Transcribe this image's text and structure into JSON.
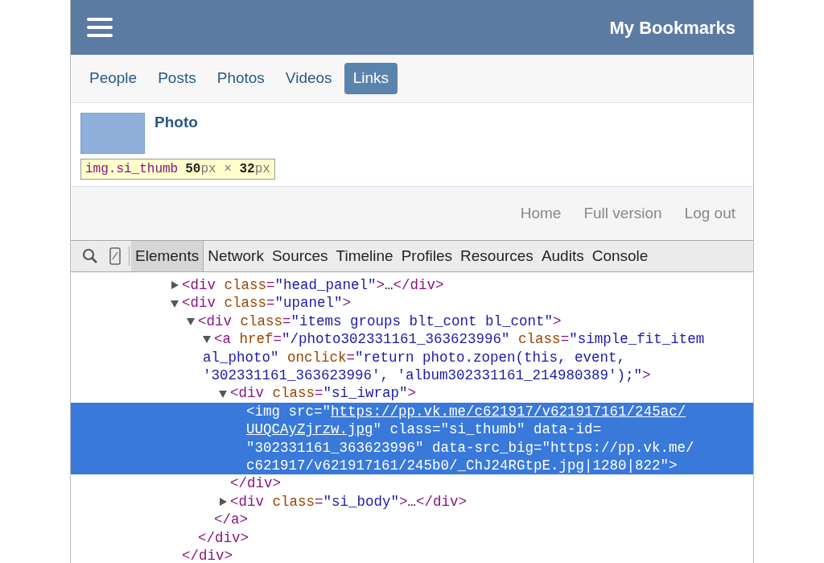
{
  "header": {
    "title": "My Bookmarks"
  },
  "tabs": [
    {
      "label": "People",
      "selected": false
    },
    {
      "label": "Posts",
      "selected": false
    },
    {
      "label": "Photos",
      "selected": false
    },
    {
      "label": "Videos",
      "selected": false
    },
    {
      "label": "Links",
      "selected": true
    }
  ],
  "item": {
    "title": "Photo",
    "highlighted": true
  },
  "tooltip": {
    "selector": "img.si_thumb",
    "size": "**50**px × **32**px"
  },
  "footer_links": [
    "Home",
    "Full version",
    "Log out"
  ],
  "devtools": {
    "tabs": [
      {
        "label": "Elements",
        "selected": true
      },
      {
        "label": "Network",
        "selected": false
      },
      {
        "label": "Sources",
        "selected": false
      },
      {
        "label": "Timeline",
        "selected": false
      },
      {
        "label": "Profiles",
        "selected": false
      },
      {
        "label": "Resources",
        "selected": false
      },
      {
        "label": "Audits",
        "selected": false
      },
      {
        "label": "Console",
        "selected": false
      }
    ],
    "tree": [
      {
        "expanded": false,
        "selected": false,
        "lines": [
          [
            {
              "kind": "tag",
              "text": "<div "
            },
            {
              "kind": "attr",
              "text": "class"
            },
            {
              "kind": "tag",
              "text": "="
            },
            {
              "kind": "value",
              "text": "\"head_panel\""
            },
            {
              "kind": "tag",
              "text": ">"
            },
            {
              "kind": "plain",
              "text": "…"
            },
            {
              "kind": "tag",
              "text": "</div>"
            }
          ]
        ]
      },
      {
        "expanded": true,
        "selected": false,
        "lines": [
          [
            {
              "kind": "tag",
              "text": "<div "
            },
            {
              "kind": "attr",
              "text": "class"
            },
            {
              "kind": "tag",
              "text": "="
            },
            {
              "kind": "value",
              "text": "\"upanel\""
            },
            {
              "kind": "tag",
              "text": ">"
            }
          ]
        ],
        "closing": "</div>",
        "children": [
          {
            "expanded": true,
            "selected": false,
            "lines": [
              [
                {
                  "kind": "tag",
                  "text": "<div "
                },
                {
                  "kind": "attr",
                  "text": "class"
                },
                {
                  "kind": "tag",
                  "text": "="
                },
                {
                  "kind": "value",
                  "text": "\"items groups blt_cont bl_cont\""
                },
                {
                  "kind": "tag",
                  "text": ">"
                }
              ]
            ],
            "closing": "</div>",
            "children": [
              {
                "expanded": true,
                "selected": false,
                "lines": [
                  [
                    {
                      "kind": "tag",
                      "text": "<a "
                    },
                    {
                      "kind": "attr",
                      "text": "href"
                    },
                    {
                      "kind": "tag",
                      "text": "="
                    },
                    {
                      "kind": "value",
                      "text": "\"/photo302331161_363623996\" "
                    },
                    {
                      "kind": "attr",
                      "text": "class"
                    },
                    {
                      "kind": "tag",
                      "text": "="
                    },
                    {
                      "kind": "value",
                      "text": "\"simple_fit_item"
                    }
                  ],
                  [
                    {
                      "kind": "value",
                      "text": "al_photo\" "
                    },
                    {
                      "kind": "attr",
                      "text": "onclick"
                    },
                    {
                      "kind": "tag",
                      "text": "="
                    },
                    {
                      "kind": "value",
                      "text": "\"return photo.zopen(this, event,"
                    }
                  ],
                  [
                    {
                      "kind": "value",
                      "text": "'302331161_363623996', 'album302331161_214980389');\""
                    },
                    {
                      "kind": "tag",
                      "text": ">"
                    }
                  ]
                ],
                "closing": "</a>",
                "children": [
                  {
                    "expanded": true,
                    "selected": false,
                    "lines": [
                      [
                        {
                          "kind": "tag",
                          "text": "<div "
                        },
                        {
                          "kind": "attr",
                          "text": "class"
                        },
                        {
                          "kind": "tag",
                          "text": "="
                        },
                        {
                          "kind": "value",
                          "text": "\"si_iwrap\""
                        },
                        {
                          "kind": "tag",
                          "text": ">"
                        }
                      ]
                    ],
                    "closing": "</div>",
                    "children": [
                      {
                        "selected": true,
                        "lines": [
                          [
                            {
                              "kind": "tag",
                              "text": "<img "
                            },
                            {
                              "kind": "attr",
                              "text": "src"
                            },
                            {
                              "kind": "tag",
                              "text": "="
                            },
                            {
                              "kind": "value",
                              "text": "\""
                            },
                            {
                              "kind": "url",
                              "text": "https://pp.vk.me/c621917/v621917161/245ac/"
                            }
                          ],
                          [
                            {
                              "kind": "url",
                              "text": "UUQCAyZjrzw.jpg"
                            },
                            {
                              "kind": "value",
                              "text": "\" "
                            },
                            {
                              "kind": "attr",
                              "text": "class"
                            },
                            {
                              "kind": "tag",
                              "text": "="
                            },
                            {
                              "kind": "value",
                              "text": "\"si_thumb\" "
                            },
                            {
                              "kind": "attr",
                              "text": "data-id"
                            },
                            {
                              "kind": "tag",
                              "text": "="
                            }
                          ],
                          [
                            {
                              "kind": "value",
                              "text": "\"302331161_363623996\" "
                            },
                            {
                              "kind": "attr",
                              "text": "data-src_big"
                            },
                            {
                              "kind": "tag",
                              "text": "="
                            },
                            {
                              "kind": "value",
                              "text": "\"https://pp.vk.me/"
                            }
                          ],
                          [
                            {
                              "kind": "value",
                              "text": "c621917/v621917161/245b0/_ChJ24RGtpE.jpg|1280|822\""
                            },
                            {
                              "kind": "tag",
                              "text": ">"
                            }
                          ]
                        ]
                      }
                    ]
                  },
                  {
                    "expanded": false,
                    "selected": false,
                    "lines": [
                      [
                        {
                          "kind": "tag",
                          "text": "<div "
                        },
                        {
                          "kind": "attr",
                          "text": "class"
                        },
                        {
                          "kind": "tag",
                          "text": "="
                        },
                        {
                          "kind": "value",
                          "text": "\"si_body\""
                        },
                        {
                          "kind": "tag",
                          "text": ">"
                        },
                        {
                          "kind": "plain",
                          "text": "…"
                        },
                        {
                          "kind": "tag",
                          "text": "</div>"
                        }
                      ]
                    ]
                  }
                ]
              }
            ]
          }
        ]
      }
    ]
  }
}
